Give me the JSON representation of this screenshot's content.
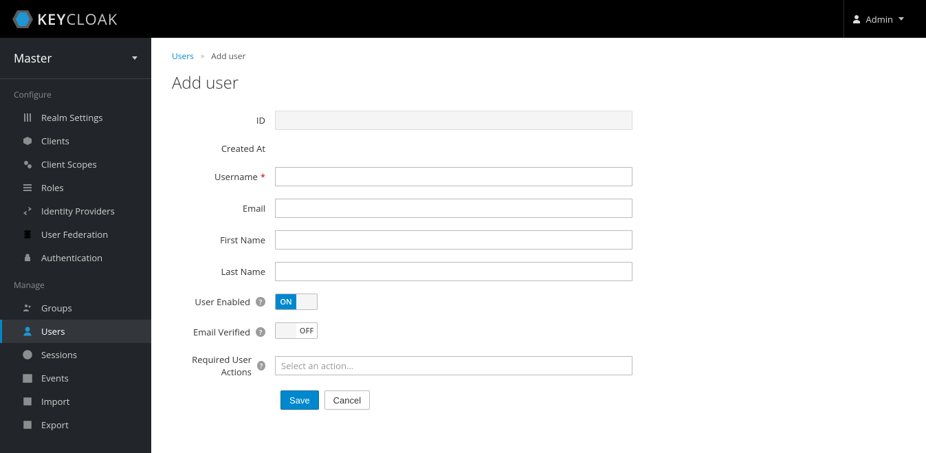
{
  "brand": {
    "name_bold": "KEY",
    "name_light": "CLOAK"
  },
  "header": {
    "user_label": "Admin"
  },
  "realm": {
    "name": "Master"
  },
  "sidebar": {
    "section_configure": "Configure",
    "section_manage": "Manage",
    "configure": [
      {
        "id": "realm-settings",
        "label": "Realm Settings"
      },
      {
        "id": "clients",
        "label": "Clients"
      },
      {
        "id": "client-scopes",
        "label": "Client Scopes"
      },
      {
        "id": "roles",
        "label": "Roles"
      },
      {
        "id": "identity-providers",
        "label": "Identity Providers"
      },
      {
        "id": "user-federation",
        "label": "User Federation"
      },
      {
        "id": "authentication",
        "label": "Authentication"
      }
    ],
    "manage": [
      {
        "id": "groups",
        "label": "Groups"
      },
      {
        "id": "users",
        "label": "Users"
      },
      {
        "id": "sessions",
        "label": "Sessions"
      },
      {
        "id": "events",
        "label": "Events"
      },
      {
        "id": "import",
        "label": "Import"
      },
      {
        "id": "export",
        "label": "Export"
      }
    ]
  },
  "breadcrumb": {
    "parent": "Users",
    "current": "Add user"
  },
  "page": {
    "title": "Add user"
  },
  "form": {
    "labels": {
      "id": "ID",
      "created_at": "Created At",
      "username": "Username",
      "email": "Email",
      "first_name": "First Name",
      "last_name": "Last Name",
      "user_enabled": "User Enabled",
      "email_verified": "Email Verified",
      "required_actions": "Required User Actions"
    },
    "values": {
      "id": "",
      "created_at": "",
      "username": "",
      "email": "",
      "first_name": "",
      "last_name": ""
    },
    "toggles": {
      "user_enabled_on": "ON",
      "email_verified_off": "OFF"
    },
    "required_actions_placeholder": "Select an action...",
    "buttons": {
      "save": "Save",
      "cancel": "Cancel"
    }
  }
}
